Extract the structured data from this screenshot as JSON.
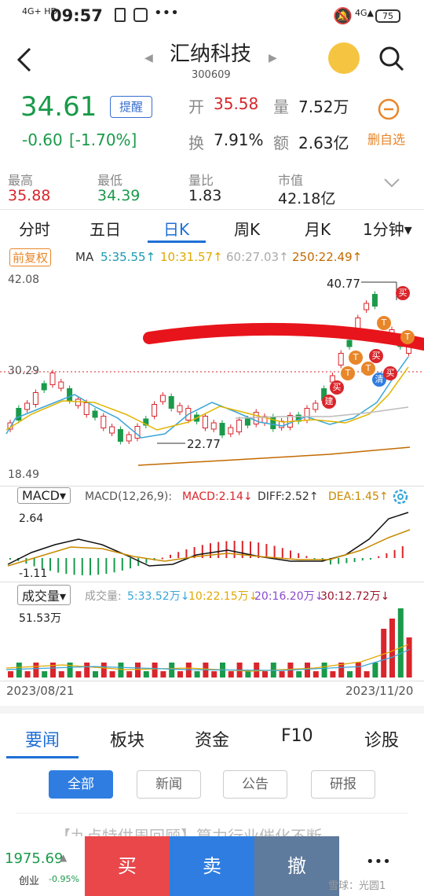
{
  "status": {
    "time": "09:57",
    "net": "4G+ HD",
    "battery": "75"
  },
  "header": {
    "name": "汇纳科技",
    "code": "300609"
  },
  "quote": {
    "price": "34.61",
    "remind": "提醒",
    "change": "-0.60",
    "pct": "[-1.70%]",
    "open_label": "开",
    "open": "35.58",
    "vol_label": "量",
    "vol": "7.52万",
    "turn_label": "换",
    "turn": "7.91%",
    "amt_label": "额",
    "amt": "2.63亿",
    "del": "删自选"
  },
  "stats": [
    {
      "label": "最高",
      "value": "35.88",
      "color": "red"
    },
    {
      "label": "最低",
      "value": "34.39",
      "color": "green"
    },
    {
      "label": "量比",
      "value": "1.83",
      "color": "dark"
    },
    {
      "label": "市值",
      "value": "42.18亿",
      "color": "dark"
    }
  ],
  "period_tabs": [
    "分时",
    "五日",
    "日K",
    "周K",
    "月K",
    "1分钟▾"
  ],
  "active_tab": "日K",
  "ma": {
    "adj": "前复权",
    "label": "MA",
    "ma5": "5:35.55↑",
    "ma10": "10:31.57↑",
    "ma20": "60:27.03↑",
    "ma250": "250:22.49↑"
  },
  "price_axis": {
    "top": "42.08",
    "mid": "30.29",
    "bottom": "18.49",
    "high_mark": "40.77",
    "low_mark": "22.77"
  },
  "macd": {
    "selector": "MACD▾",
    "params": "MACD(12,26,9):",
    "macd": "MACD:2.14↓",
    "diff": "DIFF:2.52↑",
    "dea": "DEA:1.45↑",
    "top": "2.64",
    "bottom": "-1.11"
  },
  "volume": {
    "selector": "成交量▾",
    "label": "成交量:",
    "v5": "5:33.52万↓",
    "v10": "10:22.15万↓",
    "v20": "20:16.20万↓",
    "v30": "30:12.72万↓",
    "top": "51.53万"
  },
  "dates": {
    "start": "2023/08/21",
    "end": "2023/11/20"
  },
  "markers": {
    "buy": "买",
    "t": "T",
    "build": "建",
    "clear": "清"
  },
  "news_tabs": [
    "要闻",
    "板块",
    "资金",
    "F10",
    "诊股"
  ],
  "filters": [
    "全部",
    "新闻",
    "公告",
    "研报"
  ],
  "news_peek": "【九点特供周回顾】算力行业催化不断",
  "bottom": {
    "index": "1975.69",
    "index_name": "创业",
    "index_pct": "-0.95%",
    "buy": "买",
    "sell": "卖",
    "cancel": "撤",
    "more": "•••",
    "watermark": "雪球：光圆1"
  },
  "chart_data": {
    "type": "candlestick",
    "xlim": [
      "2023/08/21",
      "2023/11/20"
    ],
    "ylim": [
      18.49,
      42.08
    ],
    "high": 40.77,
    "low": 22.77,
    "last_close": 34.61
  }
}
